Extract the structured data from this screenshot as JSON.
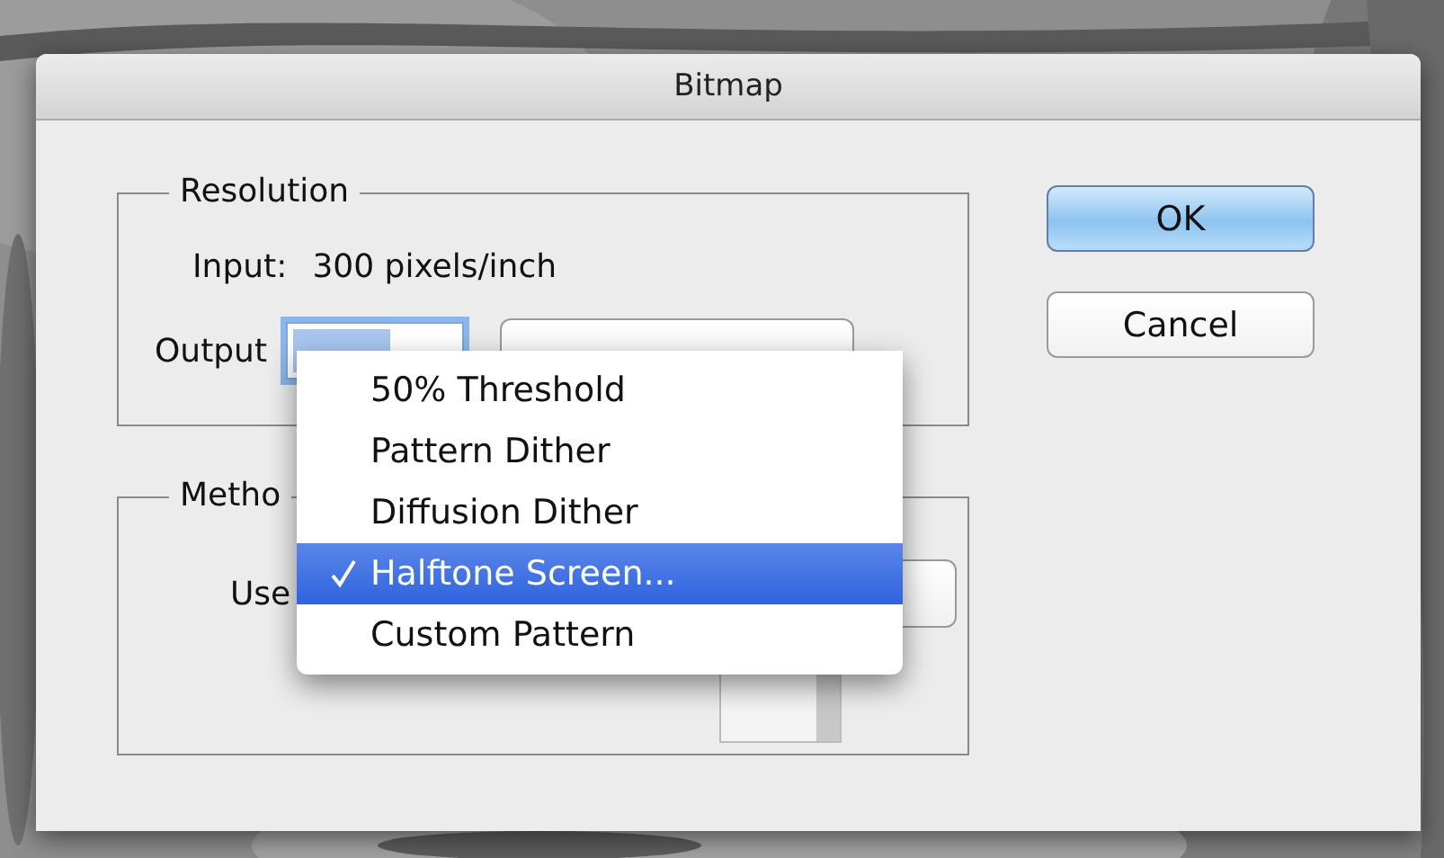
{
  "window": {
    "title": "Bitmap"
  },
  "resolution": {
    "legend": "Resolution",
    "input_label": "Input:",
    "input_value": "300 pixels/inch",
    "output_label": "Output"
  },
  "method": {
    "legend": "Metho",
    "use_label": "Use"
  },
  "menu": {
    "items": [
      {
        "label": "50% Threshold",
        "selected": false
      },
      {
        "label": "Pattern Dither",
        "selected": false
      },
      {
        "label": "Diffusion Dither",
        "selected": false
      },
      {
        "label": "Halftone Screen...",
        "selected": true
      },
      {
        "label": "Custom Pattern",
        "selected": false
      }
    ]
  },
  "buttons": [
    {
      "label": "OK",
      "default": true
    },
    {
      "label": "Cancel",
      "default": false
    }
  ]
}
